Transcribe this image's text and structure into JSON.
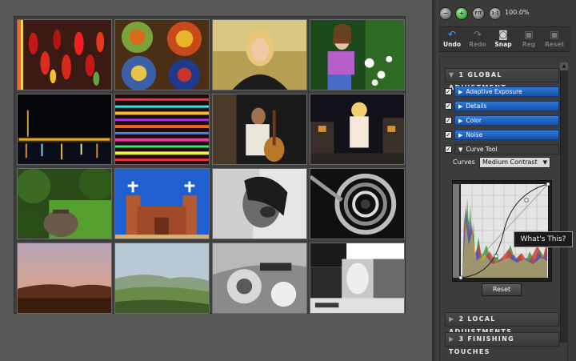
{
  "zoom": {
    "buttons": [
      {
        "icon": "zoom-out-icon",
        "glyph": "−"
      },
      {
        "icon": "zoom-in-icon",
        "glyph": "+"
      },
      {
        "icon": "fit-icon",
        "glyph": "FIT"
      },
      {
        "icon": "actual-size-icon",
        "glyph": "1:1"
      }
    ],
    "level": "100.0%"
  },
  "toolbar": {
    "undo": "Undo",
    "redo": "Redo",
    "snap": "Snap",
    "tool4": "Reg",
    "tool5": "Reset"
  },
  "sections": {
    "global": {
      "number": "1",
      "label": "GLOBAL ADJUSTMENT"
    },
    "local": {
      "number": "2",
      "label": "LOCAL ADJUSTMENTS"
    },
    "finishing": {
      "number": "3",
      "label": "FINISHING TOUCHES"
    }
  },
  "adjustments": [
    {
      "label": "Adaptive Exposure",
      "checked": true
    },
    {
      "label": "Details",
      "checked": true
    },
    {
      "label": "Color",
      "checked": true
    },
    {
      "label": "Noise",
      "checked": true
    },
    {
      "label": "Curve Tool",
      "checked": true
    }
  ],
  "curves": {
    "label": "Curves",
    "preset": "Medium Contrast",
    "reset": "Reset"
  },
  "tooltip": "What's This?",
  "thumbnails": [
    {
      "name": "thumb-peppers",
      "subject": "chili peppers"
    },
    {
      "name": "thumb-ceramic-plates",
      "subject": "painted ceramic plates"
    },
    {
      "name": "thumb-portrait-woman",
      "subject": "blonde woman portrait"
    },
    {
      "name": "thumb-girl-flowers",
      "subject": "girl with flowers"
    },
    {
      "name": "thumb-night-city",
      "subject": "night city skyline"
    },
    {
      "name": "thumb-colored-lights",
      "subject": "colored light streaks"
    },
    {
      "name": "thumb-guitarist",
      "subject": "man with guitar"
    },
    {
      "name": "thumb-statue-night",
      "subject": "statue at night"
    },
    {
      "name": "thumb-garden-pot",
      "subject": "garden with pot"
    },
    {
      "name": "thumb-church",
      "subject": "adobe church"
    },
    {
      "name": "thumb-bw-portrait",
      "subject": "black and white portrait"
    },
    {
      "name": "thumb-spiral-stairs",
      "subject": "spiral staircase"
    },
    {
      "name": "thumb-sunset-hills",
      "subject": "sunset hills"
    },
    {
      "name": "thumb-tuscany",
      "subject": "tuscany landscape"
    },
    {
      "name": "thumb-bw-motorcycle",
      "subject": "black and white motorbike"
    },
    {
      "name": "thumb-test-chart",
      "subject": "monochrome test chart"
    }
  ],
  "colors": {
    "accent_blue": "#2b7bd9",
    "panel": "#3a3a3a",
    "background": "#585858"
  }
}
